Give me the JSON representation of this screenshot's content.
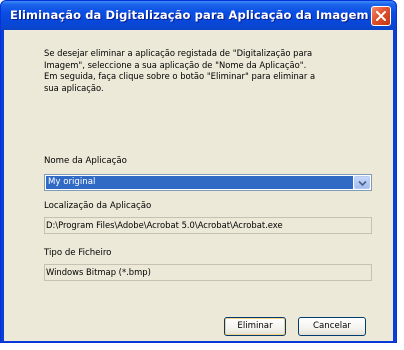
{
  "window": {
    "title": "Eliminação da Digitalização para Aplicação da Imagem",
    "close_icon": "close-icon"
  },
  "description": "Se desejar eliminar a aplicação registada de \"Digitalização para\nImagem\", seleccione a sua aplicação de \"Nome da Aplicação\".\nEm seguida, faça clique sobre o botão \"Eliminar\" para eliminar a\nsua aplicação.",
  "app_name": {
    "label": "Nome da Aplicação",
    "selected_value": "My original",
    "arrow_icon": "chevron-down-icon"
  },
  "app_location": {
    "label": "Localização da Aplicação",
    "value": "D:\\Program Files\\Adobe\\Acrobat 5.0\\Acrobat\\Acrobat.exe"
  },
  "file_type": {
    "label": "Tipo de Ficheiro",
    "value": "Windows Bitmap (*.bmp)"
  },
  "buttons": {
    "delete_label": "Eliminar",
    "cancel_label": "Cancelar"
  },
  "colors": {
    "titlebar": "#0a4ee4",
    "client_bg": "#ece9d8",
    "selection": "#316ac5",
    "close_button": "#e0512d"
  }
}
